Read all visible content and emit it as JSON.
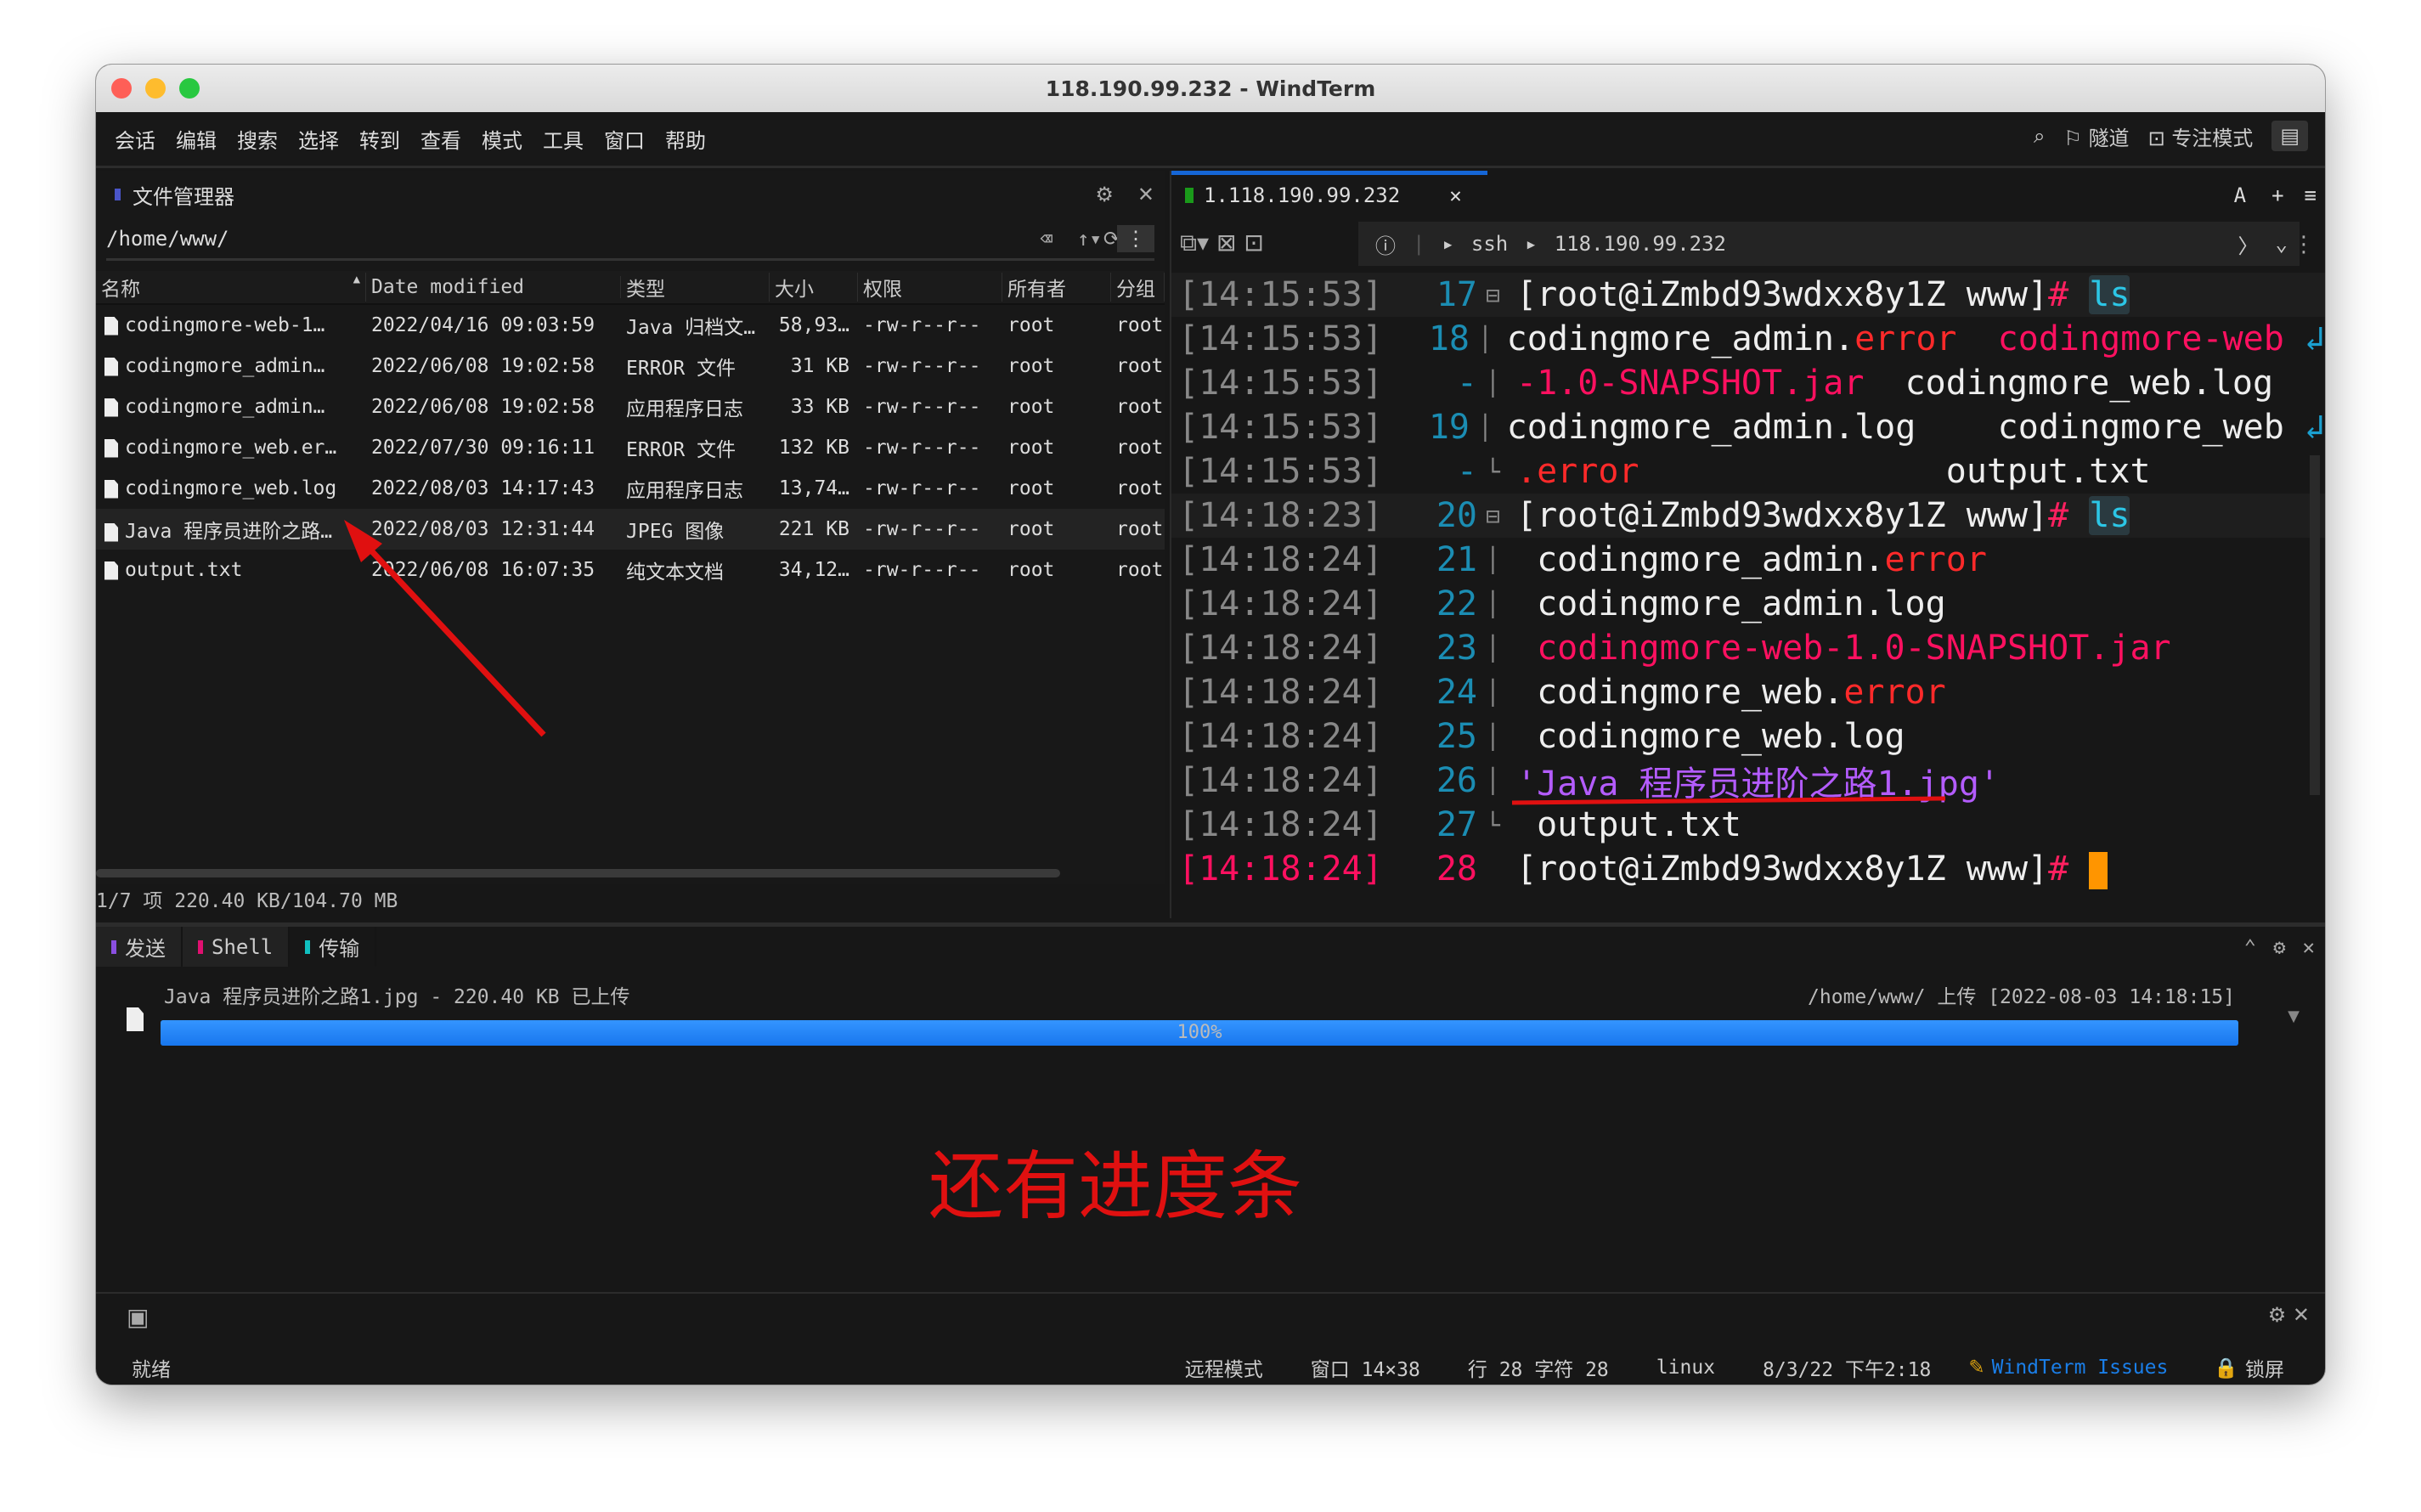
{
  "window": {
    "title": "118.190.99.232 - WindTerm"
  },
  "menu": [
    "会话",
    "编辑",
    "搜索",
    "选择",
    "转到",
    "查看",
    "模式",
    "工具",
    "窗口",
    "帮助"
  ],
  "menu_right": {
    "tunnel": "隧道",
    "focus": "专注模式"
  },
  "file_manager": {
    "title": "文件管理器",
    "path": "/home/www/",
    "columns": [
      "名称",
      "Date modified",
      "类型",
      "大小",
      "权限",
      "所有者",
      "分组"
    ],
    "rows": [
      [
        "codingmore-web-1…",
        "2022/04/16 09:03:59",
        "Java 归档文…",
        "58,93…",
        "-rw-r--r--",
        "root",
        "root"
      ],
      [
        "codingmore_admin…",
        "2022/06/08 19:02:58",
        "ERROR 文件",
        "31 KB",
        "-rw-r--r--",
        "root",
        "root"
      ],
      [
        "codingmore_admin…",
        "2022/06/08 19:02:58",
        "应用程序日志",
        "33 KB",
        "-rw-r--r--",
        "root",
        "root"
      ],
      [
        "codingmore_web.er…",
        "2022/07/30 09:16:11",
        "ERROR 文件",
        "132 KB",
        "-rw-r--r--",
        "root",
        "root"
      ],
      [
        "codingmore_web.log",
        "2022/08/03 14:17:43",
        "应用程序日志",
        "13,74…",
        "-rw-r--r--",
        "root",
        "root"
      ],
      [
        "Java 程序员进阶之路…",
        "2022/08/03 12:31:44",
        "JPEG 图像",
        "221 KB",
        "-rw-r--r--",
        "root",
        "root"
      ],
      [
        "output.txt",
        "2022/06/08 16:07:35",
        "纯文本文档",
        "34,12…",
        "-rw-r--r--",
        "root",
        "root"
      ]
    ],
    "footer": "1/7 项 220.40 KB/104.70 MB"
  },
  "terminal": {
    "tab": "1.118.190.99.232",
    "ssh": "ssh",
    "host": "118.190.99.232",
    "font_btn": "A",
    "lines": [
      {
        "ts": "[14:15:53]",
        "n": "17",
        "f": "⊟",
        "seg": [
          [
            "[root@iZmbd93wdxx8y1Z www]",
            "#eee"
          ],
          [
            "# ",
            "#ff2060"
          ],
          [
            "ls",
            "#2cc6e6"
          ]
        ]
      },
      {
        "ts": "[14:15:53]",
        "n": "18",
        "f": "│",
        "seg": [
          [
            "codingmore_admin.",
            "#eee"
          ],
          [
            "error",
            "#ff2a2a"
          ],
          [
            "  ",
            "#eee"
          ],
          [
            "codingmore-web",
            "#ff1060"
          ],
          [
            " ↲",
            "#1ba0d0"
          ]
        ]
      },
      {
        "ts": "[14:15:53]",
        "n": "-",
        "f": "│",
        "seg": [
          [
            "-1.0-SNAPSHOT.jar",
            "#ff1060"
          ],
          [
            "  codingmore_web.log",
            "#eee"
          ]
        ]
      },
      {
        "ts": "[14:15:53]",
        "n": "19",
        "f": "│",
        "seg": [
          [
            "codingmore_admin.log    codingmore_web",
            "#eee"
          ],
          [
            " ↲",
            "#1ba0d0"
          ]
        ]
      },
      {
        "ts": "[14:15:53]",
        "n": "-",
        "f": "└",
        "seg": [
          [
            ".error",
            "#ff2a2a"
          ],
          [
            "               output.txt",
            "#eee"
          ]
        ]
      },
      {
        "ts": "[14:18:23]",
        "n": "20",
        "f": "⊟",
        "seg": [
          [
            "[root@iZmbd93wdxx8y1Z www]",
            "#eee"
          ],
          [
            "# ",
            "#ff2060"
          ],
          [
            "ls",
            "#2cc6e6"
          ]
        ]
      },
      {
        "ts": "[14:18:24]",
        "n": "21",
        "f": "│",
        "seg": [
          [
            " codingmore_admin.",
            "#eee"
          ],
          [
            "error",
            "#ff2a2a"
          ]
        ]
      },
      {
        "ts": "[14:18:24]",
        "n": "22",
        "f": "│",
        "seg": [
          [
            " codingmore_admin.log",
            "#eee"
          ]
        ]
      },
      {
        "ts": "[14:18:24]",
        "n": "23",
        "f": "│",
        "seg": [
          [
            " codingmore-web-1.0-SNAPSHOT.jar",
            "#ff1060"
          ]
        ]
      },
      {
        "ts": "[14:18:24]",
        "n": "24",
        "f": "│",
        "seg": [
          [
            " codingmore_web.",
            "#eee"
          ],
          [
            "error",
            "#ff2a2a"
          ]
        ]
      },
      {
        "ts": "[14:18:24]",
        "n": "25",
        "f": "│",
        "seg": [
          [
            " codingmore_web.log",
            "#eee"
          ]
        ]
      },
      {
        "ts": "[14:18:24]",
        "n": "26",
        "f": "│",
        "seg": [
          [
            "'Java 程序员进阶之路1.jpg'",
            "#b45cff"
          ]
        ]
      },
      {
        "ts": "[14:18:24]",
        "n": "27",
        "f": "└",
        "seg": [
          [
            " output.txt",
            "#eee"
          ]
        ]
      },
      {
        "ts": "[14:18:24]",
        "n": "28",
        "f": "",
        "seg": [
          [
            "[root@iZmbd93wdxx8y1Z www]",
            "#eee"
          ],
          [
            "# ",
            "#ff2060"
          ]
        ]
      }
    ]
  },
  "bottom": {
    "tabs": [
      "发送",
      "Shell",
      "传输"
    ],
    "transfer": {
      "file": "Java 程序员进阶之路1.jpg - 220.40 KB 已上传",
      "dest": "/home/www/ 上传 [2022-08-03 14:18:15]",
      "progress_label": "100%",
      "progress": 100
    },
    "annotation": "还有进度条"
  },
  "statusbar": {
    "ready": "就绪",
    "mode": "远程模式",
    "window": "窗口 14×38",
    "pos": "行 28 字符 28",
    "os": "linux",
    "time": "8/3/22 下午2:18",
    "issues": "WindTerm Issues",
    "lock": "锁屏"
  }
}
